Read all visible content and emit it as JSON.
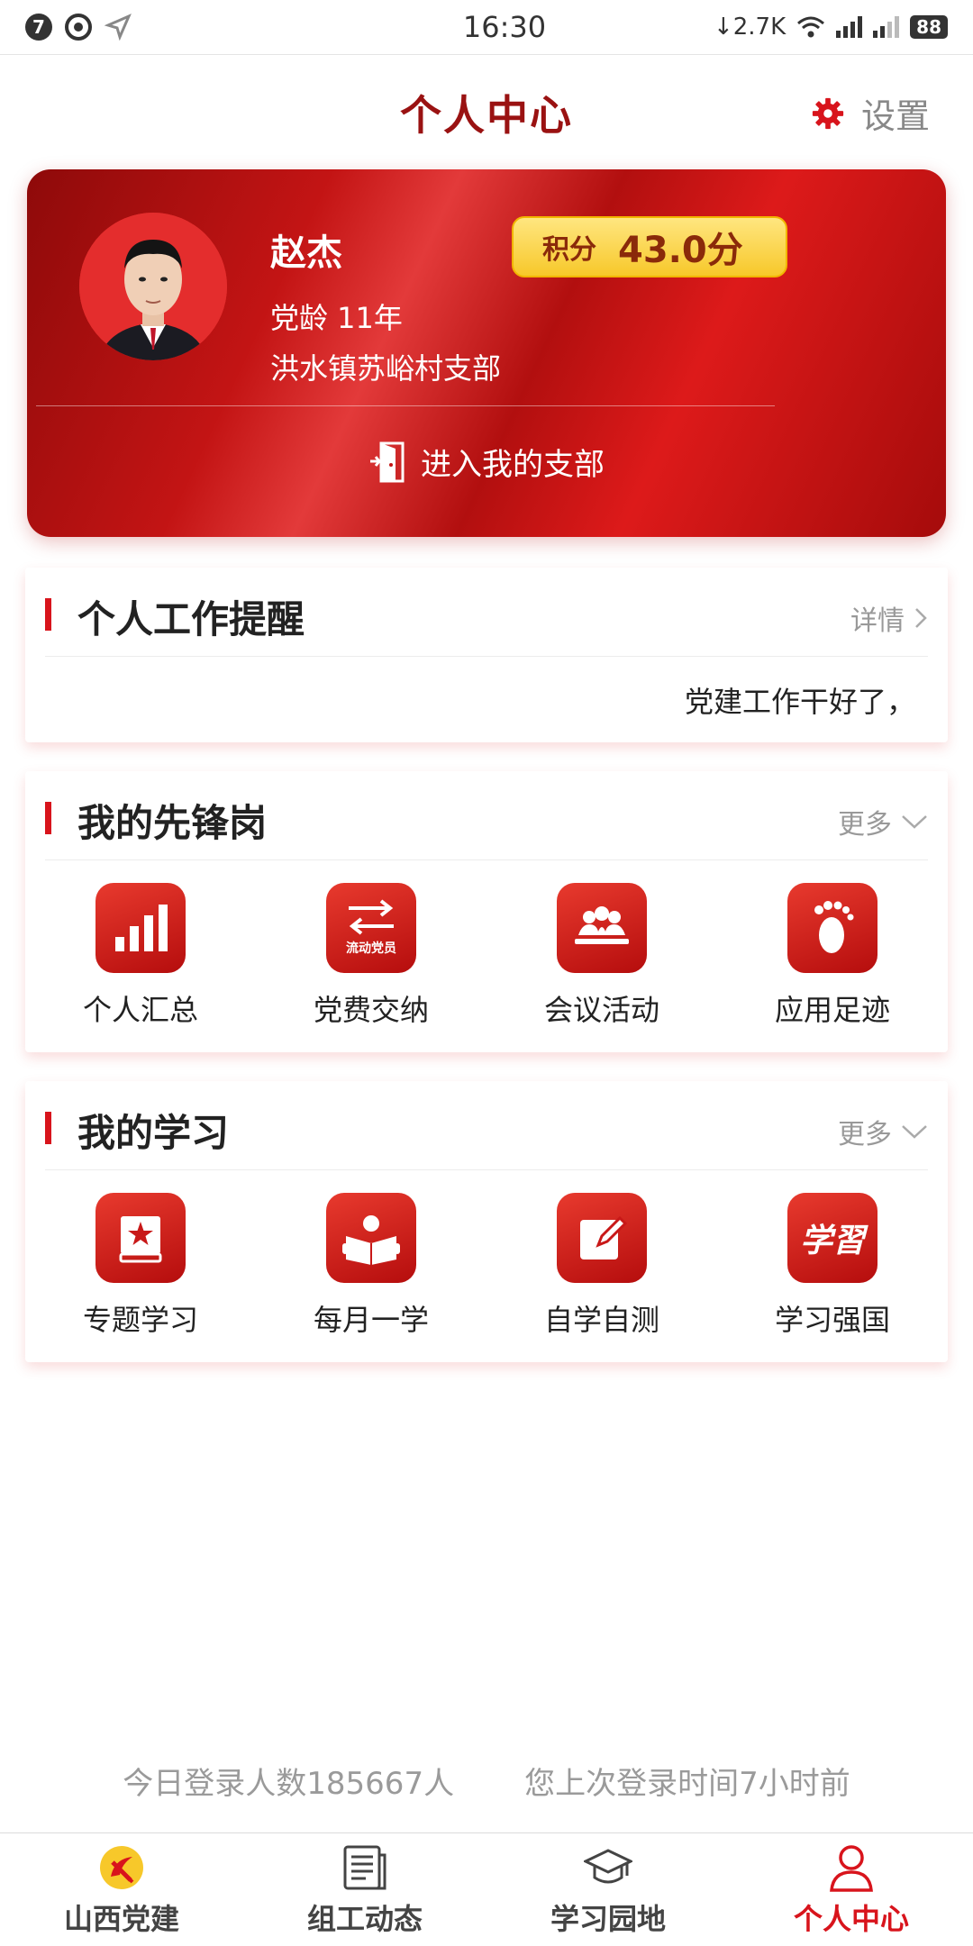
{
  "status_bar": {
    "notification_count": "7",
    "time": "16:30",
    "net_speed": "↓2.7K",
    "battery": "88"
  },
  "header": {
    "title": "个人中心",
    "settings_label": "设置"
  },
  "profile": {
    "name": "赵杰",
    "score_label": "积分",
    "score_value": "43.0分",
    "party_age": "党龄 11年",
    "branch": "洪水镇苏峪村支部",
    "enter_branch_label": "进入我的支部"
  },
  "reminder": {
    "title": "个人工作提醒",
    "more_label": "详情",
    "text": "党建工作干好了，"
  },
  "vanguard": {
    "title": "我的先锋岗",
    "more_label": "更多",
    "items": [
      {
        "label": "个人汇总",
        "icon": "bar-chart-icon"
      },
      {
        "label": "党费交纳",
        "icon": "transfer-icon",
        "sublabel": "流动党员"
      },
      {
        "label": "会议活动",
        "icon": "meeting-icon"
      },
      {
        "label": "应用足迹",
        "icon": "footprint-icon"
      }
    ]
  },
  "study": {
    "title": "我的学习",
    "more_label": "更多",
    "items": [
      {
        "label": "专题学习",
        "icon": "star-book-icon"
      },
      {
        "label": "每月一学",
        "icon": "reading-icon"
      },
      {
        "label": "自学自测",
        "icon": "edit-icon"
      },
      {
        "label": "学习强国",
        "icon": "xuexi-logo-icon",
        "glyph": "学習"
      }
    ]
  },
  "footer": {
    "login_count": "今日登录人数185667人",
    "last_login": "您上次登录时间7小时前"
  },
  "bottom_nav": {
    "items": [
      {
        "label": "山西党建",
        "icon": "party-emblem-icon"
      },
      {
        "label": "组工动态",
        "icon": "news-icon"
      },
      {
        "label": "学习园地",
        "icon": "graduation-cap-icon"
      },
      {
        "label": "个人中心",
        "icon": "person-icon"
      }
    ],
    "active_index": 3
  },
  "colors": {
    "brand_red": "#d8141c",
    "title_red": "#9a1212",
    "gold": "#f7c82a"
  }
}
